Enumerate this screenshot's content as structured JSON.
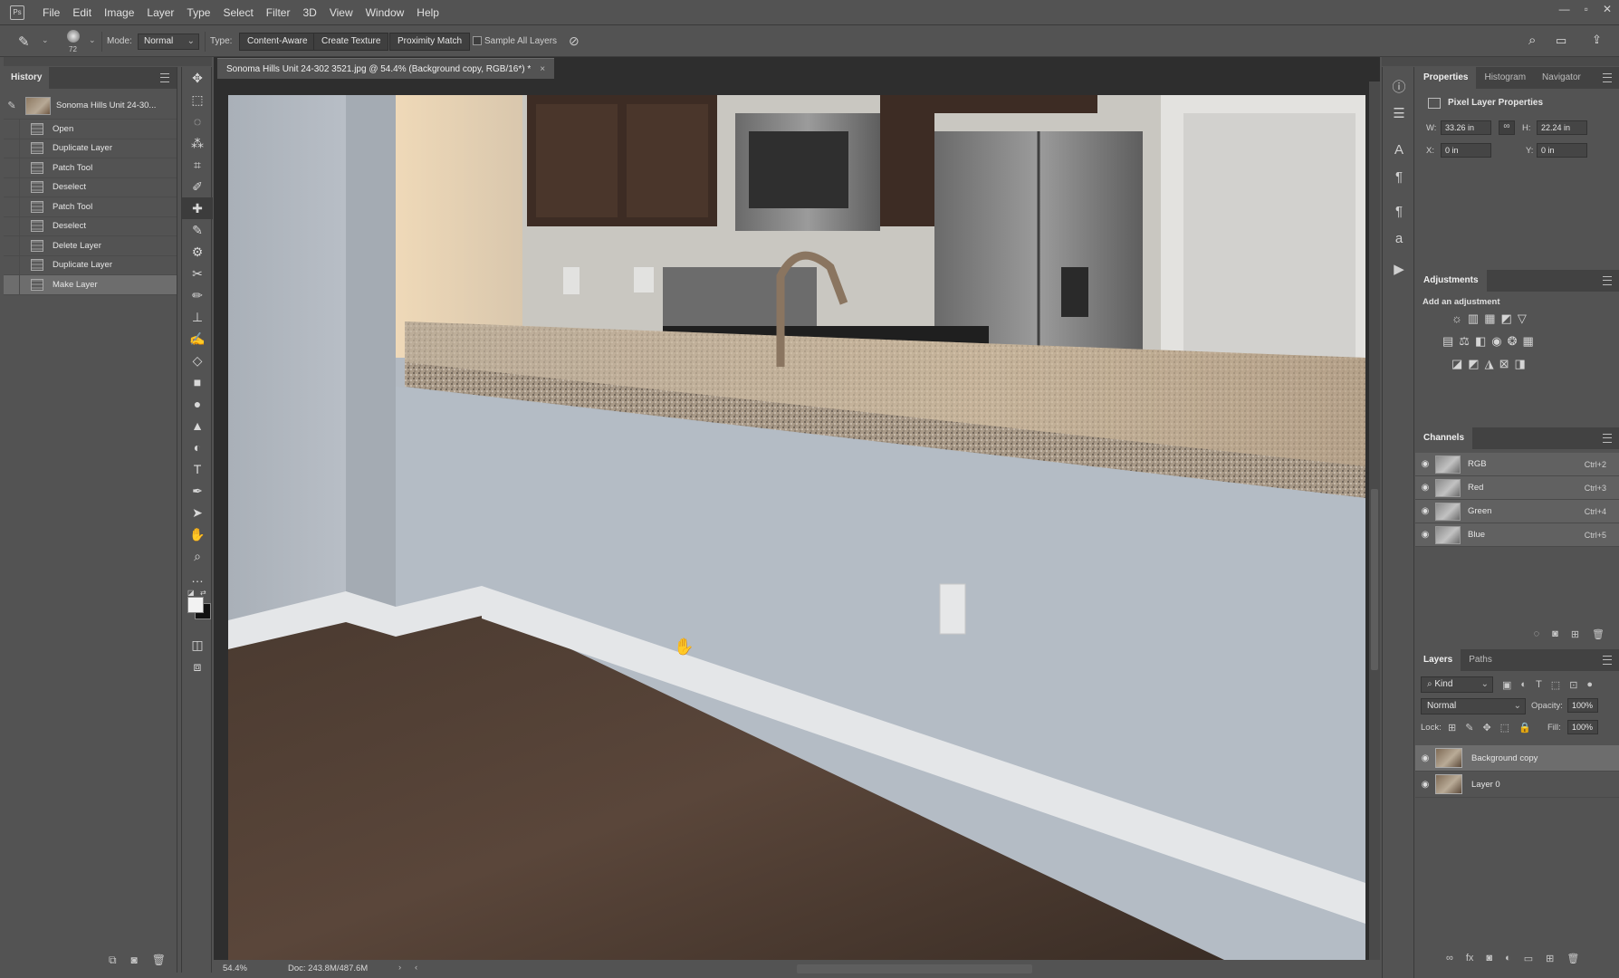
{
  "app": {
    "logo": "Ps"
  },
  "menu": [
    "File",
    "Edit",
    "Image",
    "Layer",
    "Type",
    "Select",
    "Filter",
    "3D",
    "View",
    "Window",
    "Help"
  ],
  "window_controls": {
    "minimize": "—",
    "restore": "▫",
    "close": "✕"
  },
  "options": {
    "brush_size": "72",
    "mode_label": "Mode:",
    "mode_value": "Normal",
    "type_label": "Type:",
    "type_buttons": [
      "Content-Aware",
      "Create Texture",
      "Proximity Match"
    ],
    "sample_all_layers": "Sample All Layers"
  },
  "history": {
    "title": "History",
    "snapshot": "Sonoma Hills Unit 24-30...",
    "items": [
      "Open",
      "Duplicate Layer",
      "Patch Tool",
      "Deselect",
      "Patch Tool",
      "Deselect",
      "Delete Layer",
      "Duplicate Layer",
      "Make Layer"
    ],
    "selected_index": 8
  },
  "document": {
    "tab_title": "Sonoma Hills Unit 24-302 3521.jpg @ 54.4% (Background copy, RGB/16*) *",
    "close": "×",
    "zoom": "54.4%",
    "doc_size": "Doc: 243.8M/487.6M"
  },
  "properties": {
    "tabs": [
      "Properties",
      "Histogram",
      "Navigator"
    ],
    "heading": "Pixel Layer Properties",
    "w_label": "W:",
    "w_value": "33.26 in",
    "h_label": "H:",
    "h_value": "22.24 in",
    "x_label": "X:",
    "x_value": "0 in",
    "y_label": "Y:",
    "y_value": "0 in"
  },
  "adjustments": {
    "title": "Adjustments",
    "subtitle": "Add an adjustment"
  },
  "channels": {
    "title": "Channels",
    "rows": [
      {
        "name": "RGB",
        "shortcut": "Ctrl+2"
      },
      {
        "name": "Red",
        "shortcut": "Ctrl+3"
      },
      {
        "name": "Green",
        "shortcut": "Ctrl+4"
      },
      {
        "name": "Blue",
        "shortcut": "Ctrl+5"
      }
    ]
  },
  "layers": {
    "tabs": [
      "Layers",
      "Paths"
    ],
    "kind": "Kind",
    "blend_mode": "Normal",
    "opacity_label": "Opacity:",
    "opacity_value": "100%",
    "lock_label": "Lock:",
    "fill_label": "Fill:",
    "fill_value": "100%",
    "rows": [
      {
        "name": "Background copy",
        "selected": true
      },
      {
        "name": "Layer 0",
        "selected": false
      }
    ]
  },
  "colors": {
    "accent_bg": "#535353",
    "dark_bg": "#2e2e2e",
    "selected_row": "#6d6d6d"
  }
}
